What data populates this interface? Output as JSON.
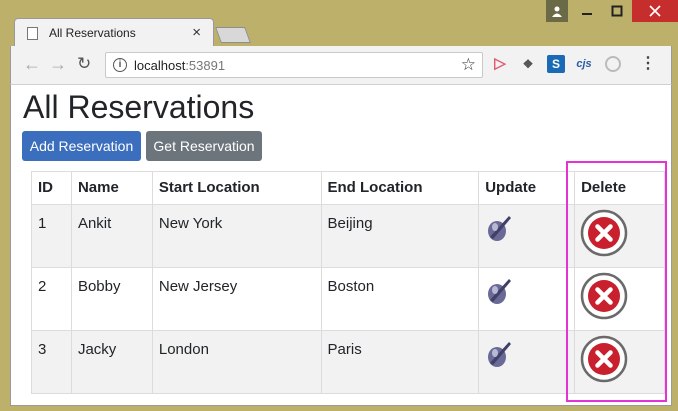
{
  "browser": {
    "tab_title": "All Reservations",
    "tab_close": "×",
    "url_host": "localhost",
    "url_port": ":53891",
    "ext_s_label": "S",
    "ext_cjs_label": "cjs"
  },
  "page": {
    "title": "All Reservations",
    "add_button": "Add Reservation",
    "get_button": "Get Reservation"
  },
  "table": {
    "headers": {
      "id": "ID",
      "name": "Name",
      "start": "Start Location",
      "end": "End Location",
      "update": "Update",
      "delete": "Delete"
    },
    "rows": [
      {
        "id": "1",
        "name": "Ankit",
        "start": "New York",
        "end": "Beijing"
      },
      {
        "id": "2",
        "name": "Bobby",
        "start": "New Jersey",
        "end": "Boston"
      },
      {
        "id": "3",
        "name": "Jacky",
        "start": "London",
        "end": "Paris"
      }
    ]
  },
  "colors": {
    "highlight": "#e333d4",
    "delete_red": "#c8202c",
    "primary": "#3b6ebd",
    "secondary": "#6d757c"
  }
}
